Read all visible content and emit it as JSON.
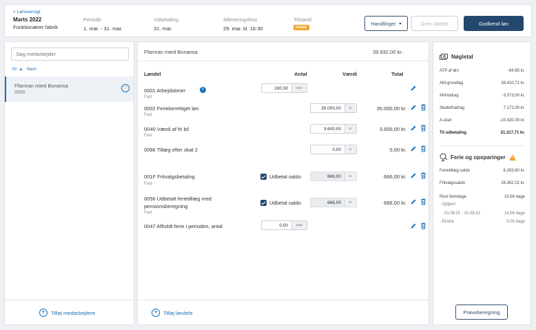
{
  "header": {
    "back": "< Lønoversigt",
    "period_title": "Marts 2022",
    "period_sub": "Funktionærer fabrik",
    "meta": [
      {
        "label": "Periode",
        "value": "1. mar. - 31. mar."
      },
      {
        "label": "Udbetaling",
        "value": "31. mar."
      },
      {
        "label": "Afleveringsfrist",
        "value": "29. mar. kl. 16:30"
      },
      {
        "label": "Tilstand",
        "badge": "Kladde"
      }
    ],
    "actions_label": "Handlinger",
    "save_draft_label": "Gem kladde",
    "approve_label": "Godkend løn"
  },
  "left": {
    "search_placeholder": "Søg medarbejder",
    "col_nr": "Nr. ▲",
    "col_name": "Navn",
    "employee": {
      "name": "Ffamran mied Bunansa",
      "number": "0005"
    },
    "add_label": "Tilføj medarbejdere"
  },
  "center": {
    "employee_name": "Ffamran mied Bunansa",
    "total": "39.932,00 kr.",
    "headers": {
      "item": "Løndel",
      "qty": "Antal",
      "value": "Værdi",
      "total": "Total"
    },
    "rows": [
      {
        "title": "0001 Arbejdstimer",
        "sub": "Fast",
        "qty": "160,30",
        "qty_unit": "timer"
      },
      {
        "title": "0002 Ferieberettiget løn",
        "sub": "Fast",
        "value": "35.000,00",
        "value_unit": "kr.",
        "total": "35.000,00 kr."
      },
      {
        "title": "0040 Værdi af fri bil",
        "sub": "Fast",
        "value": "3.600,00",
        "value_unit": "kr.",
        "total": "3.600,00 kr."
      },
      {
        "title": "0086 Tillæg efter skat 2",
        "sub": "",
        "value": "0,00",
        "value_unit": "kr.",
        "total": "0,00 kr."
      },
      {
        "title": "001F Fritvalgsbetaling",
        "sub": "Fast",
        "check_label": "Udbetal saldo",
        "value": "666,00",
        "value_unit": "kr.",
        "total": "666,00 kr."
      },
      {
        "title": "0056 Udbetalt ferietillæg med",
        "title2": "pensionsberegning",
        "sub": "Fast",
        "check_label": "Udbetal saldo",
        "value": "666,00",
        "value_unit": "kr.",
        "total": "666,00 kr."
      },
      {
        "title": "0047 Afholdt ferie i perioden, antal",
        "sub": "",
        "qty": "0,00",
        "qty_unit": "dage"
      }
    ],
    "add_label": "Tilføj løndele"
  },
  "right": {
    "key_title": "Nøgletal",
    "key": [
      {
        "k": "ATP af løn",
        "v": "-94,65 kr."
      },
      {
        "k": "AM-grundlag",
        "v": "38.410,71 kr."
      },
      {
        "k": "AM-bidrag",
        "v": "-3.073,00 kr."
      },
      {
        "k": "Skattefradrag",
        "v": "7.171,00 kr."
      },
      {
        "k": "A-skat",
        "v": "-10.420,00 kr."
      },
      {
        "k": "Til udbetaling",
        "v": "21.317,71 kr."
      }
    ],
    "vac_title": "Ferie og opsparinger",
    "vac": [
      {
        "k": "Ferietillæg saldo",
        "v": "6.283,60 kr."
      },
      {
        "k": "Fritvalgssaldo",
        "v": "26.362,02 kr."
      },
      {
        "k": "Rest feriedage",
        "v": "19,56 dage"
      },
      {
        "k": "- Optjent",
        "v": ""
      },
      {
        "k": "01.09.21 - 31.08.22",
        "v": "14,56 dage"
      },
      {
        "k": "- Ekstra",
        "v": "5,00 dage"
      }
    ],
    "calc_label": "Prøveberegning"
  }
}
